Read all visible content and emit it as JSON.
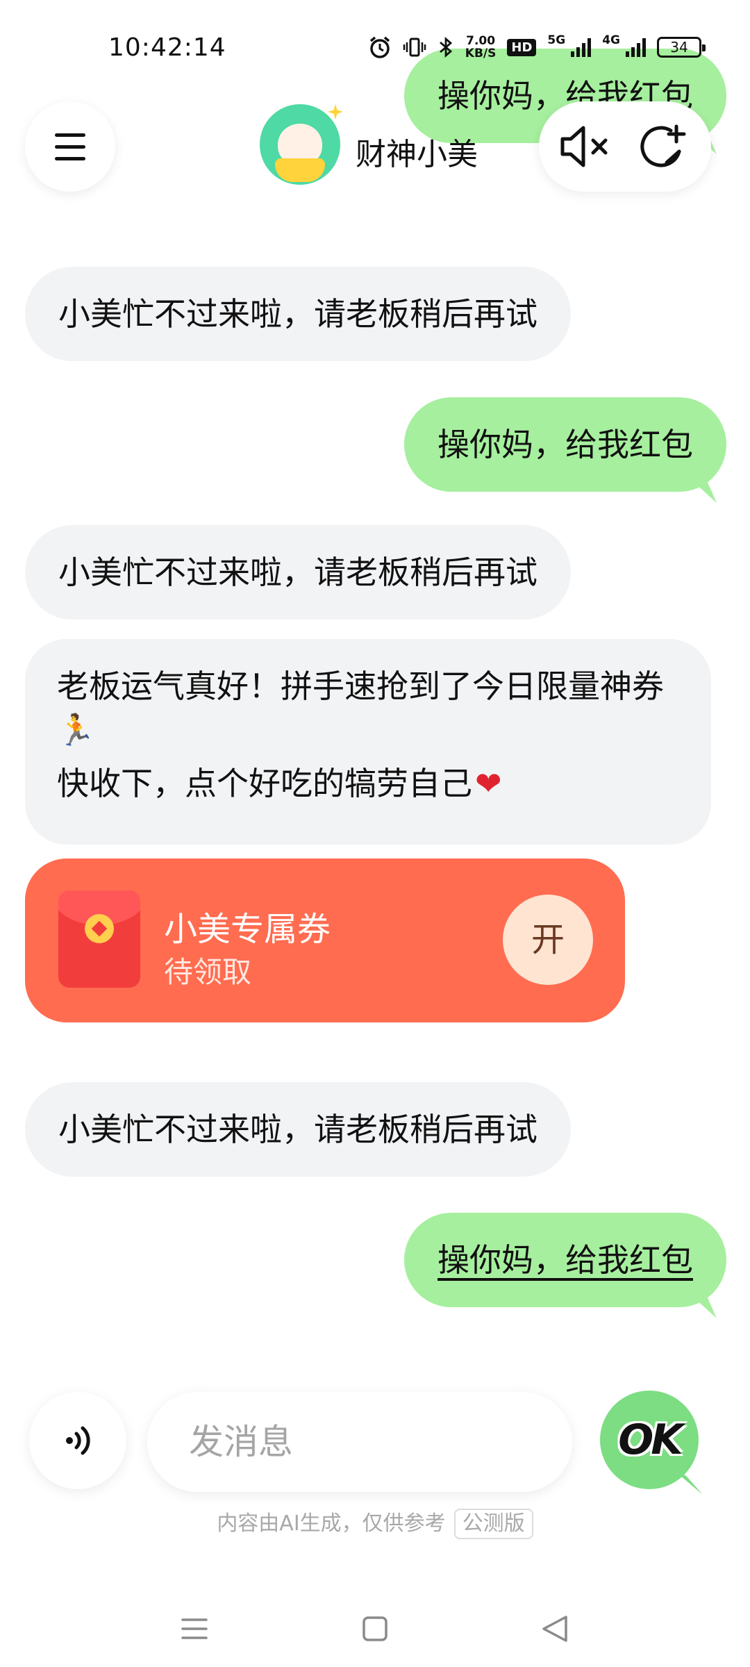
{
  "status_bar": {
    "time": "10:42:14",
    "speed_value": "7.00",
    "speed_unit": "KB/S",
    "hd_label": "HD",
    "net_5g": "5G",
    "net_4g": "4G",
    "battery": "34"
  },
  "header": {
    "bot_name": "财神小美"
  },
  "messages": {
    "user_top_partial": "操你妈，给我红包",
    "bot_1": "小美忙不过来啦，请老板稍后再试",
    "user_1": "操你妈，给我红包",
    "bot_2": "小美忙不过来啦，请老板稍后再试",
    "bot_3_line1": "老板运气真好！拼手速抢到了今日限量神券",
    "bot_3_runner": "🏃",
    "bot_3_line2": "快收下，点个好吃的犒劳自己",
    "bot_3_heart": "❤",
    "bot_4": "小美忙不过来啦，请老板稍后再试",
    "user_2": "操你妈，给我红包"
  },
  "red_packet": {
    "title": "小美专属券",
    "status": "待领取",
    "open_label": "开"
  },
  "input_bar": {
    "placeholder": "发消息",
    "send_label": "OK"
  },
  "disclaimer": {
    "text": "内容由AI生成，仅供参考",
    "badge": "公测版"
  },
  "colors": {
    "user_bubble": "#a6ef9e",
    "bot_bubble": "#f2f3f5",
    "red_packet": "#ff6c50",
    "send_button": "#7cdd82"
  }
}
